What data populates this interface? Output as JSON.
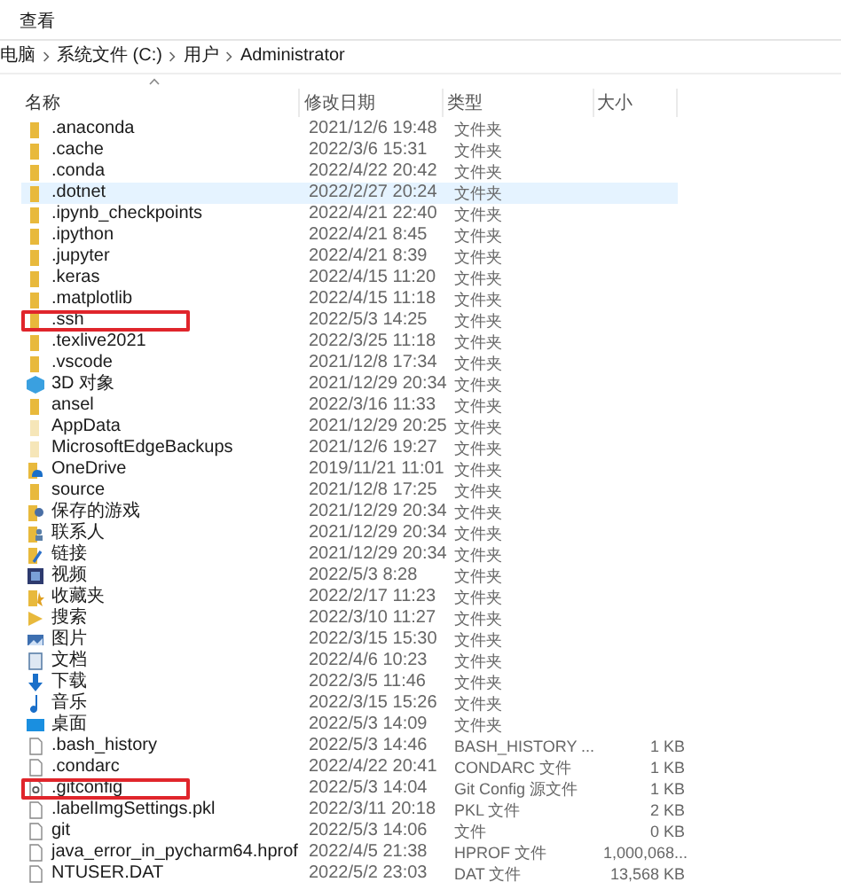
{
  "menu": [
    "查看"
  ],
  "breadcrumb": [
    "电脑",
    "系统文件 (C:)",
    "用户",
    "Administrator"
  ],
  "columns": [
    {
      "label": "名称",
      "sorted": true
    },
    {
      "label": "修改日期",
      "sorted": false
    },
    {
      "label": "类型",
      "sorted": false
    },
    {
      "label": "大小",
      "sorted": false
    }
  ],
  "rows": [
    {
      "kind": "folder",
      "name": ".anaconda",
      "date": "2021/12/6 19:48",
      "type": "文件夹",
      "selected": false,
      "marked": false
    },
    {
      "kind": "folder",
      "name": ".cache",
      "date": "2022/3/6 15:31",
      "type": "文件夹",
      "selected": false,
      "marked": false
    },
    {
      "kind": "folder",
      "name": ".conda",
      "date": "2022/4/22 20:42",
      "type": "文件夹",
      "selected": false,
      "marked": false
    },
    {
      "kind": "folder",
      "name": ".dotnet",
      "date": "2022/2/27 20:24",
      "type": "文件夹",
      "selected": true,
      "marked": false
    },
    {
      "kind": "folder",
      "name": ".ipynb_checkpoints",
      "date": "2022/4/21 22:40",
      "type": "文件夹",
      "selected": false,
      "marked": false
    },
    {
      "kind": "folder",
      "name": ".ipython",
      "date": "2022/4/21 8:45",
      "type": "文件夹",
      "selected": false,
      "marked": false
    },
    {
      "kind": "folder",
      "name": ".jupyter",
      "date": "2022/4/21 8:39",
      "type": "文件夹",
      "selected": false,
      "marked": false
    },
    {
      "kind": "folder",
      "name": ".keras",
      "date": "2022/4/15 11:20",
      "type": "文件夹",
      "selected": false,
      "marked": false
    },
    {
      "kind": "folder",
      "name": ".matplotlib",
      "date": "2022/4/15 11:18",
      "type": "文件夹",
      "selected": false,
      "marked": false
    },
    {
      "kind": "folder",
      "name": ".ssh",
      "date": "2022/5/3 14:25",
      "type": "文件夹",
      "selected": false,
      "marked": true
    },
    {
      "kind": "folder",
      "name": ".texlive2021",
      "date": "2022/3/25 11:18",
      "type": "文件夹",
      "selected": false,
      "marked": false
    },
    {
      "kind": "folder",
      "name": ".vscode",
      "date": "2021/12/8 17:34",
      "type": "文件夹",
      "selected": false,
      "marked": false
    },
    {
      "kind": "cube",
      "name": "3D 对象",
      "date": "2021/12/29 20:34",
      "type": "文件夹",
      "selected": false,
      "marked": false
    },
    {
      "kind": "folder",
      "name": "ansel",
      "date": "2022/3/16 11:33",
      "type": "文件夹",
      "selected": false,
      "marked": false
    },
    {
      "kind": "hidden",
      "name": "AppData",
      "date": "2021/12/29 20:25",
      "type": "文件夹",
      "selected": false,
      "marked": false
    },
    {
      "kind": "hidden",
      "name": "MicrosoftEdgeBackups",
      "date": "2021/12/6 19:27",
      "type": "文件夹",
      "selected": false,
      "marked": false
    },
    {
      "kind": "cloud",
      "name": "OneDrive",
      "date": "2019/11/21 11:01",
      "type": "文件夹",
      "selected": false,
      "marked": false
    },
    {
      "kind": "folder",
      "name": "source",
      "date": "2021/12/8 17:25",
      "type": "文件夹",
      "selected": false,
      "marked": false
    },
    {
      "kind": "game",
      "name": "保存的游戏",
      "date": "2021/12/29 20:34",
      "type": "文件夹",
      "selected": false,
      "marked": false
    },
    {
      "kind": "contacts",
      "name": "联系人",
      "date": "2021/12/29 20:34",
      "type": "文件夹",
      "selected": false,
      "marked": false
    },
    {
      "kind": "links",
      "name": "链接",
      "date": "2021/12/29 20:34",
      "type": "文件夹",
      "selected": false,
      "marked": false
    },
    {
      "kind": "video",
      "name": "视频",
      "date": "2022/5/3 8:28",
      "type": "文件夹",
      "selected": false,
      "marked": false
    },
    {
      "kind": "star",
      "name": "收藏夹",
      "date": "2022/2/17 11:23",
      "type": "文件夹",
      "selected": false,
      "marked": false
    },
    {
      "kind": "search",
      "name": "搜索",
      "date": "2022/3/10 11:27",
      "type": "文件夹",
      "selected": false,
      "marked": false
    },
    {
      "kind": "picture",
      "name": "图片",
      "date": "2022/3/15 15:30",
      "type": "文件夹",
      "selected": false,
      "marked": false
    },
    {
      "kind": "document",
      "name": "文档",
      "date": "2022/4/6 10:23",
      "type": "文件夹",
      "selected": false,
      "marked": false
    },
    {
      "kind": "download",
      "name": "下载",
      "date": "2022/3/5 11:46",
      "type": "文件夹",
      "selected": false,
      "marked": false
    },
    {
      "kind": "music",
      "name": "音乐",
      "date": "2022/3/15 15:26",
      "type": "文件夹",
      "selected": false,
      "marked": false
    },
    {
      "kind": "desktop",
      "name": "桌面",
      "date": "2022/5/3 14:09",
      "type": "文件夹",
      "selected": false,
      "marked": false
    },
    {
      "kind": "file",
      "name": ".bash_history",
      "date": "2022/5/3 14:46",
      "type": "BASH_HISTORY ...",
      "size": "1 KB",
      "selected": false,
      "marked": false
    },
    {
      "kind": "file",
      "name": ".condarc",
      "date": "2022/4/22 20:41",
      "type": "CONDARC 文件",
      "size": "1 KB",
      "selected": false,
      "marked": false
    },
    {
      "kind": "config",
      "name": ".gitconfig",
      "date": "2022/5/3 14:04",
      "type": "Git Config 源文件",
      "size": "1 KB",
      "selected": false,
      "marked": true
    },
    {
      "kind": "file",
      "name": ".labelImgSettings.pkl",
      "date": "2022/3/11 20:18",
      "type": "PKL 文件",
      "size": "2 KB",
      "selected": false,
      "marked": false
    },
    {
      "kind": "file",
      "name": "git",
      "date": "2022/5/3 14:06",
      "type": "文件",
      "size": "0 KB",
      "selected": false,
      "marked": false
    },
    {
      "kind": "file",
      "name": "java_error_in_pycharm64.hprof",
      "date": "2022/4/5 21:38",
      "type": "HPROF 文件",
      "size": "1,000,068...",
      "selected": false,
      "marked": false
    },
    {
      "kind": "file",
      "name": "NTUSER.DAT",
      "date": "2022/5/2 23:03",
      "type": "DAT 文件",
      "size": "13,568 KB",
      "selected": false,
      "marked": false
    }
  ]
}
